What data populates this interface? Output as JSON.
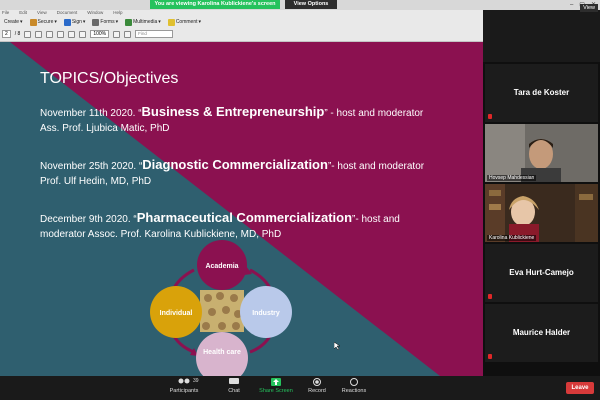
{
  "zoom": {
    "share_banner": "You are viewing Karolina Kublickiene's screen",
    "view_options": "View Options",
    "view_label": "View",
    "participants_count": "39",
    "controls": {
      "participants": "Participants",
      "chat": "Chat",
      "share_screen": "Share Screen",
      "record": "Record",
      "reactions": "Reactions",
      "leave": "Leave"
    },
    "participants": [
      {
        "name": "Tara de Koster",
        "video": false
      },
      {
        "name": "Hovsep Mahdessian",
        "video": true
      },
      {
        "name": "Karolina Kublickiene",
        "video": true
      },
      {
        "name": "Eva Hurt-Camejo",
        "video": false
      },
      {
        "name": "Maurice Halder",
        "video": false
      }
    ]
  },
  "acrobat": {
    "menu": [
      "File",
      "Edit",
      "View",
      "Document",
      "Window",
      "Help"
    ],
    "tools": [
      "Secure",
      "Sign",
      "Forms",
      "Multimedia",
      "Comment"
    ],
    "page_current": "2",
    "page_total": "/ 8",
    "zoom_level": "100%",
    "find_placeholder": "Find",
    "create_label": "Create"
  },
  "slide": {
    "title": "TOPICS/Objectives",
    "topics": [
      {
        "date": "November 11th 2020. “",
        "highlight": "Business & Entrepreneurship",
        "rest": "” - host and moderator Ass. Prof. Ljubica Matic, PhD"
      },
      {
        "date": "November 25th 2020. “",
        "highlight": "Diagnostic Commercialization",
        "rest": "”- host and moderator Prof. Ulf Hedin, MD, PhD"
      },
      {
        "date": "December 9th 2020. “",
        "highlight": "Pharmaceutical Commercialization",
        "rest": "”- host and moderator Assoc. Prof. Karolina Kublickiene, MD, PhD"
      }
    ],
    "diagram": {
      "top": "Academia",
      "right": "Industry",
      "bottom": "Health care",
      "left": "Individual"
    },
    "colors": {
      "teal": "#2f5f6f",
      "magenta": "#8b1150",
      "academia": "#8b1150",
      "industry": "#b9c9ea",
      "health": "#d8b4cd",
      "individual": "#d9a20a"
    }
  }
}
